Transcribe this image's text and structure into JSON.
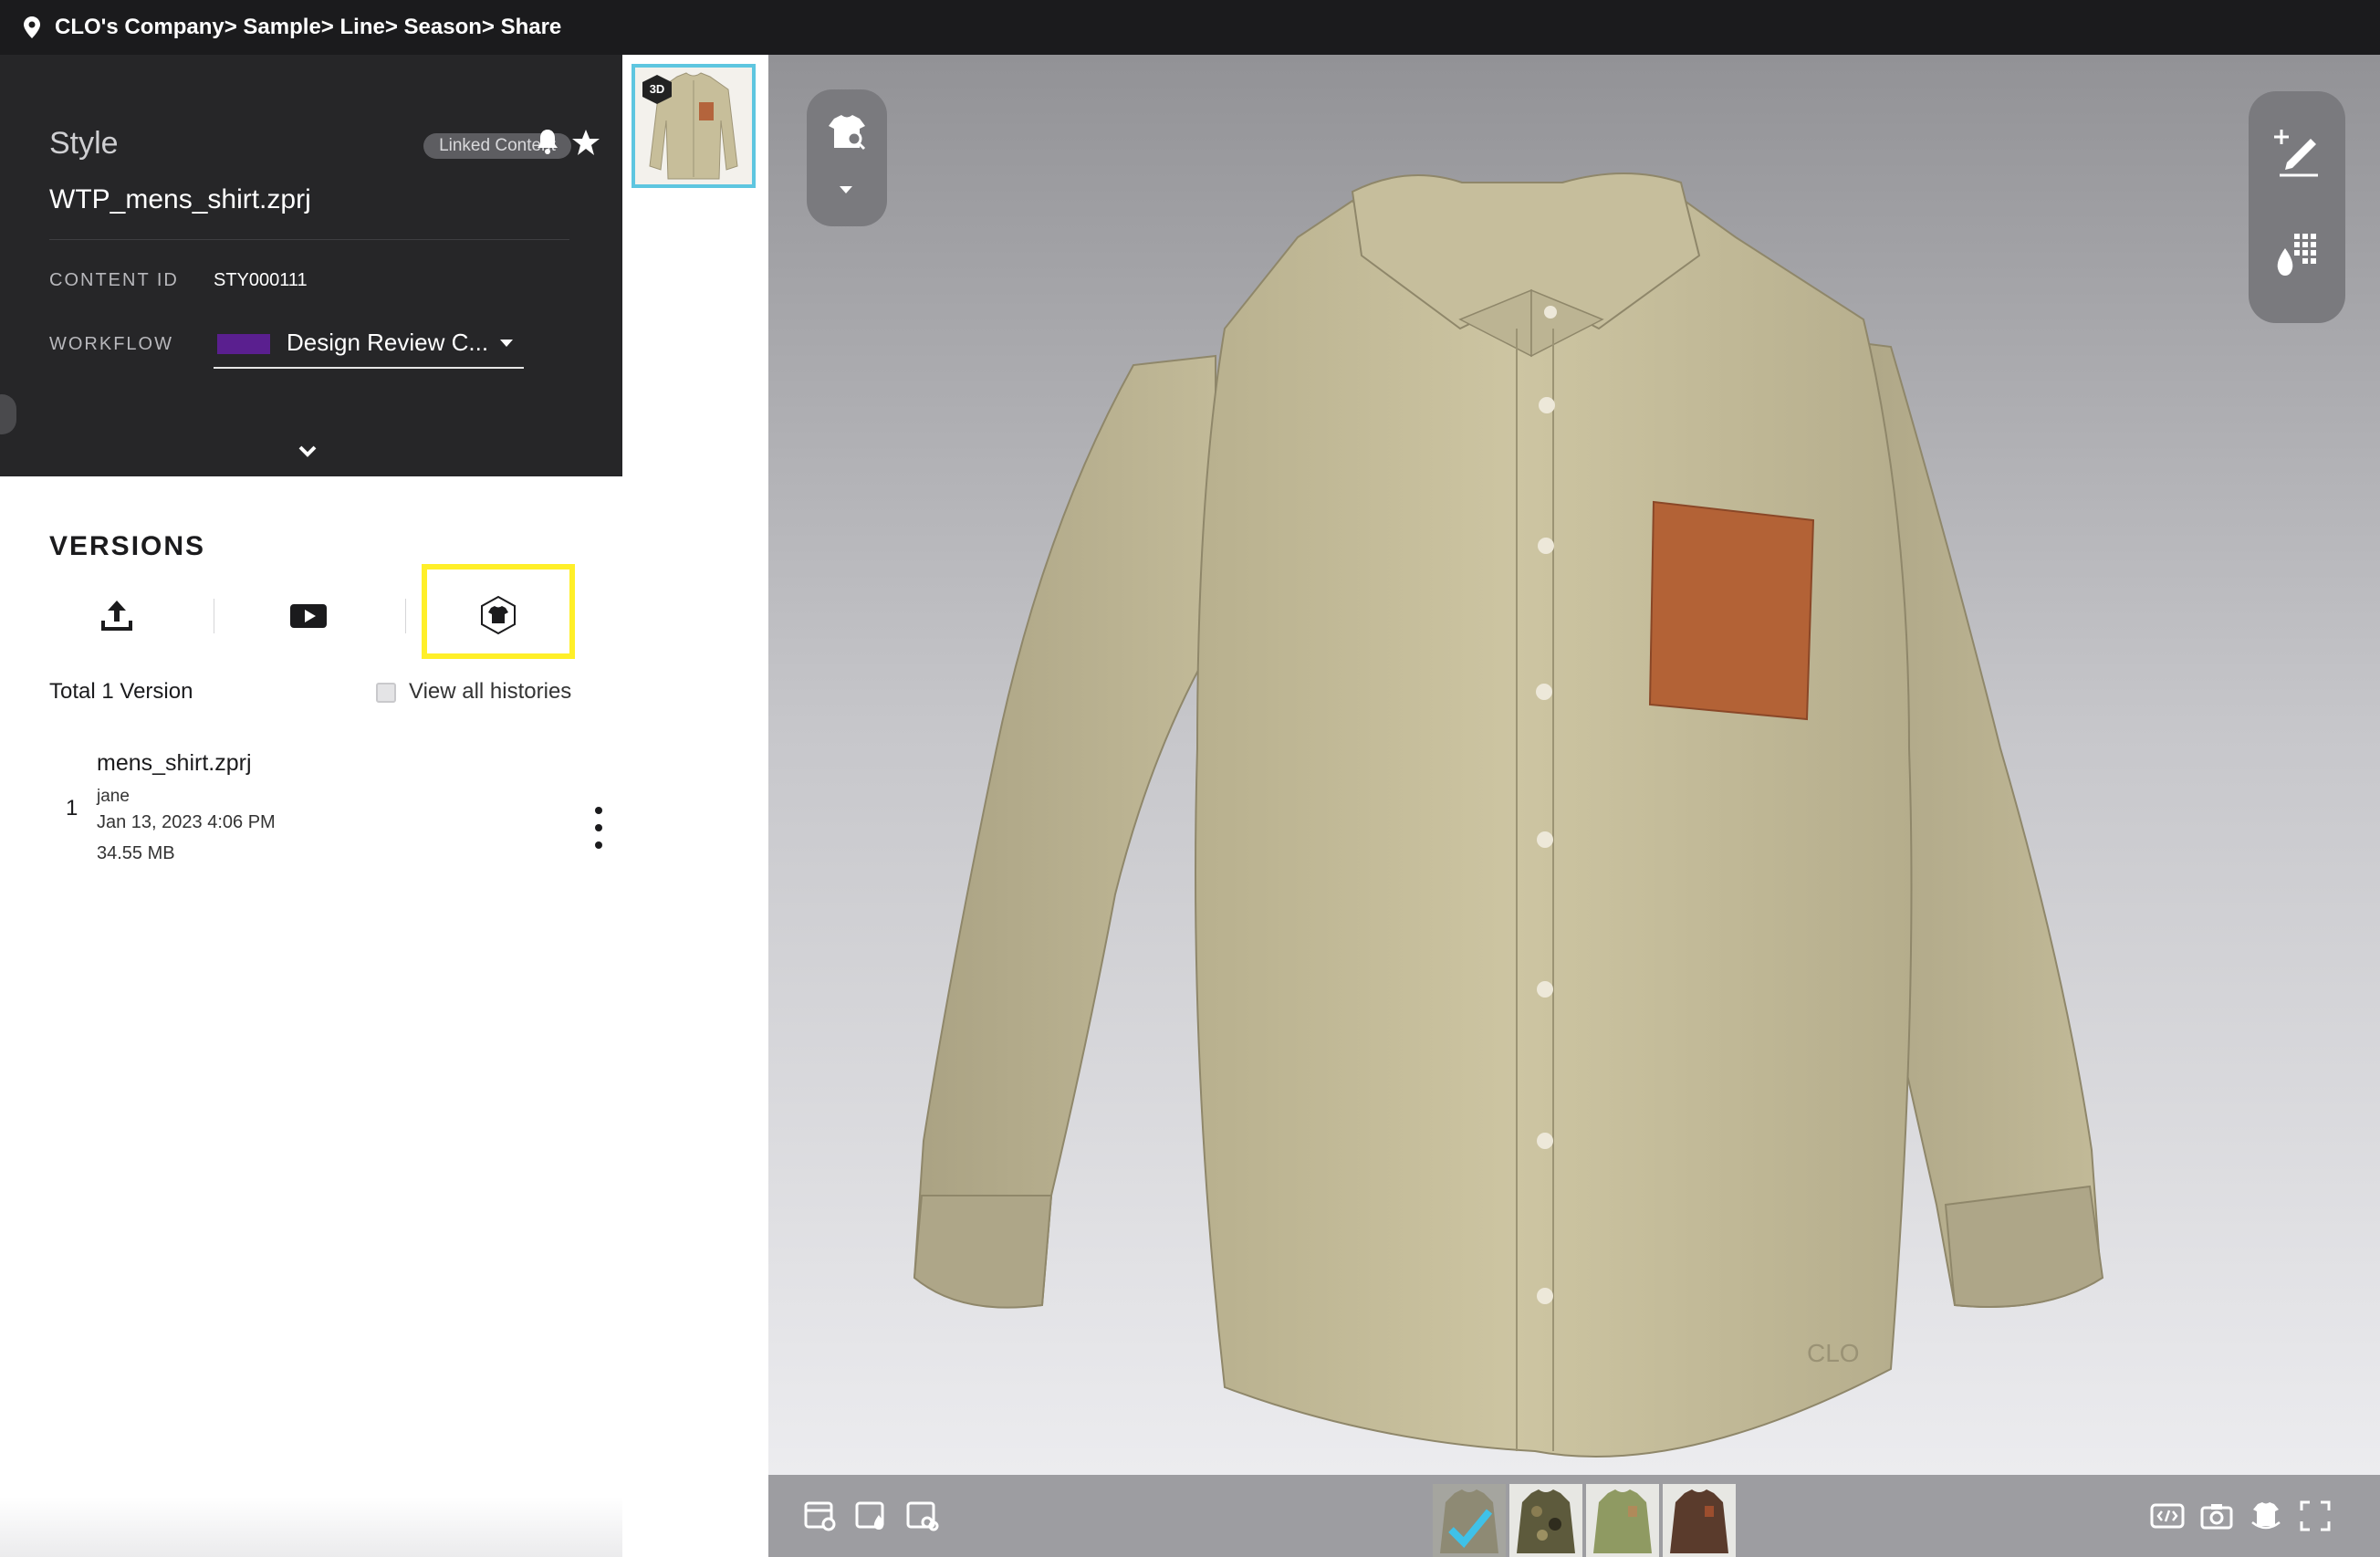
{
  "breadcrumb": [
    "CLO's Company",
    "Sample",
    "Line",
    "Season",
    "Share"
  ],
  "breadcrumb_separator": "> ",
  "style_panel": {
    "title": "Style",
    "badge": "Linked Content",
    "file_name": "WTP_mens_shirt.zprj",
    "content_id_label": "CONTENT ID",
    "content_id_value": "STY000111",
    "workflow_label": "WORKFLOW",
    "workflow_value": "Design Review C...",
    "workflow_color": "#5a1f8f"
  },
  "versions": {
    "title": "VERSIONS",
    "total_label": "Total 1 Version",
    "view_all_label": "View all histories",
    "view_all_checked": false,
    "items": [
      {
        "number": "1",
        "file": "mens_shirt.zprj",
        "user": "jane",
        "date": "Jan 13, 2023 4:06 PM",
        "size": "34.55 MB"
      }
    ]
  },
  "thumbnail_badge": "3D",
  "highlight_color": "#ffef28",
  "icons": [
    "map-pin-icon",
    "bell-icon",
    "star-icon",
    "chevron-down-icon",
    "upload-icon",
    "video-icon",
    "3d-garment-icon",
    "garment-search-icon",
    "caret-down-icon",
    "add-annotation-icon",
    "colorway-icon",
    "render-settings-icon",
    "material-icon",
    "fabric-grid-icon",
    "embed-code-icon",
    "camera-icon",
    "turntable-icon",
    "fullscreen-icon",
    "check-icon"
  ],
  "colorways": [
    {
      "name": "khaki-selected",
      "color": "#8e8a74",
      "selected": true
    },
    {
      "name": "camo",
      "color": "#5d5a3c",
      "selected": false
    },
    {
      "name": "olive",
      "color": "#8f9a62",
      "selected": false
    },
    {
      "name": "brown",
      "color": "#5a3b2c",
      "selected": false
    }
  ]
}
